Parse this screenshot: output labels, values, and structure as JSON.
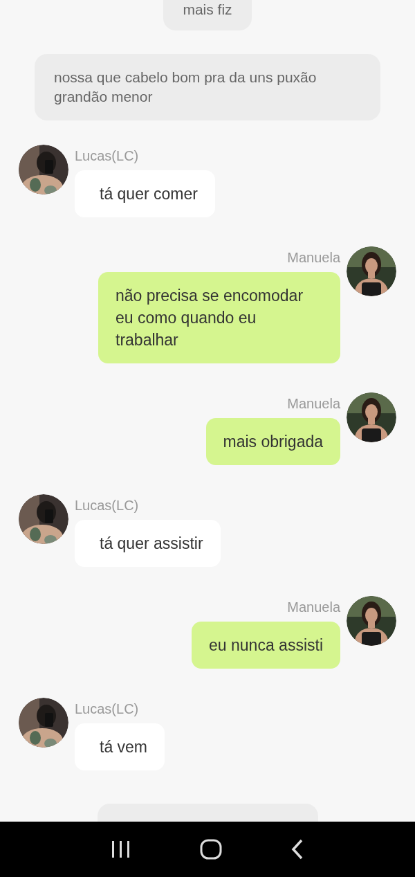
{
  "messages": [
    {
      "kind": "narration",
      "text": "mais fiz"
    },
    {
      "kind": "narration",
      "text": "nossa que cabelo bom pra da uns puxão grandão menor"
    },
    {
      "kind": "incoming",
      "sender": "Lucas(LC)",
      "text": "tá quer comer"
    },
    {
      "kind": "outgoing",
      "sender": "Manuela",
      "text": "não precisa se encomodar eu como quando eu trabalhar"
    },
    {
      "kind": "outgoing",
      "sender": "Manuela",
      "text": "mais obrigada"
    },
    {
      "kind": "incoming",
      "sender": "Lucas(LC)",
      "text": "tá quer assistir"
    },
    {
      "kind": "outgoing",
      "sender": "Manuela",
      "text": "eu nunca assisti"
    },
    {
      "kind": "incoming",
      "sender": "Lucas(LC)",
      "text": "tá vem"
    },
    {
      "kind": "narration"
    }
  ]
}
